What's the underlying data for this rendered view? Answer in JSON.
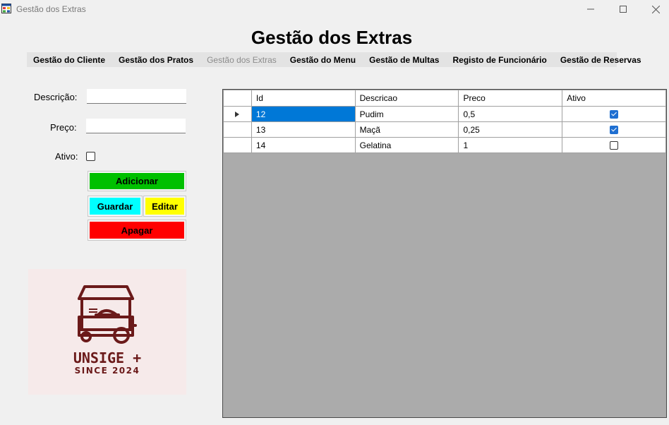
{
  "window": {
    "title": "Gestão dos Extras"
  },
  "page_title": "Gestão dos Extras",
  "menu": [
    {
      "label": "Gestão do Cliente",
      "enabled": true
    },
    {
      "label": "Gestão dos Pratos",
      "enabled": true
    },
    {
      "label": "Gestão dos Extras",
      "enabled": false
    },
    {
      "label": "Gestão do Menu",
      "enabled": true
    },
    {
      "label": "Gestão de Multas",
      "enabled": true
    },
    {
      "label": "Registo de Funcionário",
      "enabled": true
    },
    {
      "label": "Gestão de Reservas",
      "enabled": true
    }
  ],
  "form": {
    "descricao_label": "Descrição:",
    "descricao_value": "",
    "preco_label": "Preço:",
    "preco_value": "",
    "ativo_label": "Ativo:",
    "ativo_checked": false
  },
  "buttons": {
    "adicionar": "Adicionar",
    "guardar": "Guardar",
    "editar": "Editar",
    "apagar": "Apagar"
  },
  "colors": {
    "adicionar": "#00c000",
    "guardar": "#00ffff",
    "editar": "#ffff00",
    "apagar": "#ff0000",
    "logo": "#6b1a1a"
  },
  "logo": {
    "line1": "UNSIGE +",
    "line2": "SINCE 2024"
  },
  "table": {
    "columns": [
      "Id",
      "Descricao",
      "Preco",
      "Ativo"
    ],
    "rows": [
      {
        "id": "12",
        "descricao": "Pudim",
        "preco": "0,5",
        "ativo": true,
        "current": true
      },
      {
        "id": "13",
        "descricao": "Maçã",
        "preco": "0,25",
        "ativo": true,
        "current": false
      },
      {
        "id": "14",
        "descricao": "Gelatina",
        "preco": "1",
        "ativo": false,
        "current": false
      }
    ]
  }
}
